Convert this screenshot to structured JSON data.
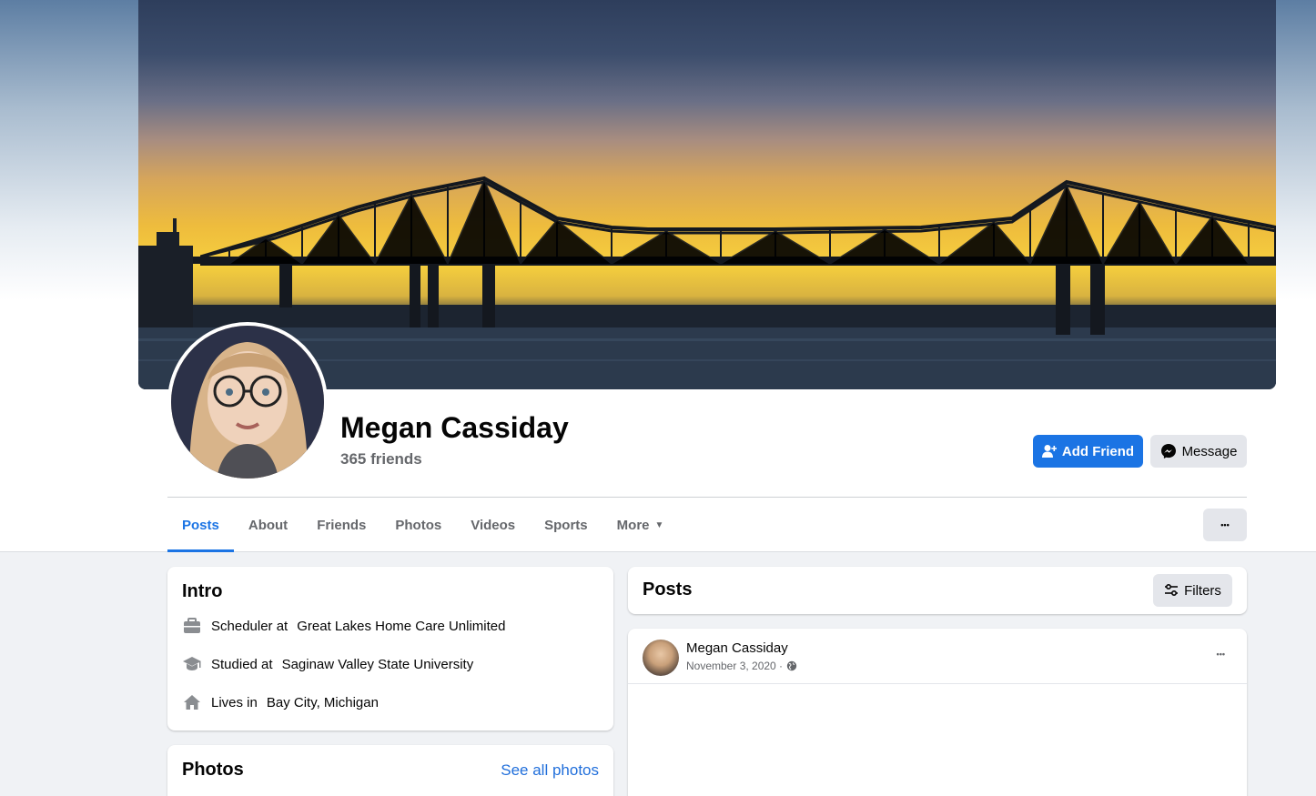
{
  "profile": {
    "name": "Megan Cassiday",
    "friends": "365 friends"
  },
  "actions": {
    "add_friend": "Add Friend",
    "message": "Message",
    "more_dots": "•••"
  },
  "tabs": [
    {
      "label": "Posts",
      "active": true
    },
    {
      "label": "About"
    },
    {
      "label": "Friends"
    },
    {
      "label": "Photos"
    },
    {
      "label": "Videos"
    },
    {
      "label": "Sports"
    },
    {
      "label": "More"
    }
  ],
  "intro": {
    "title": "Intro",
    "items": [
      {
        "icon": "briefcase-icon",
        "prefix": "Scheduler at",
        "value": "Great Lakes Home Care Unlimited"
      },
      {
        "icon": "graduation-cap-icon",
        "prefix": "Studied at",
        "value": "Saginaw Valley State University"
      },
      {
        "icon": "home-icon",
        "prefix": "Lives in",
        "value": "Bay City, Michigan"
      }
    ]
  },
  "photos": {
    "title": "Photos",
    "see_all": "See all photos"
  },
  "posts": {
    "title": "Posts",
    "filters": "Filters"
  },
  "post": {
    "author": "Megan Cassiday",
    "date": "November 3, 2020 ·",
    "dots": "•••"
  },
  "colors": {
    "accent": "#1b74e4",
    "link": "#216fdb",
    "secondary_text": "#65676b"
  }
}
